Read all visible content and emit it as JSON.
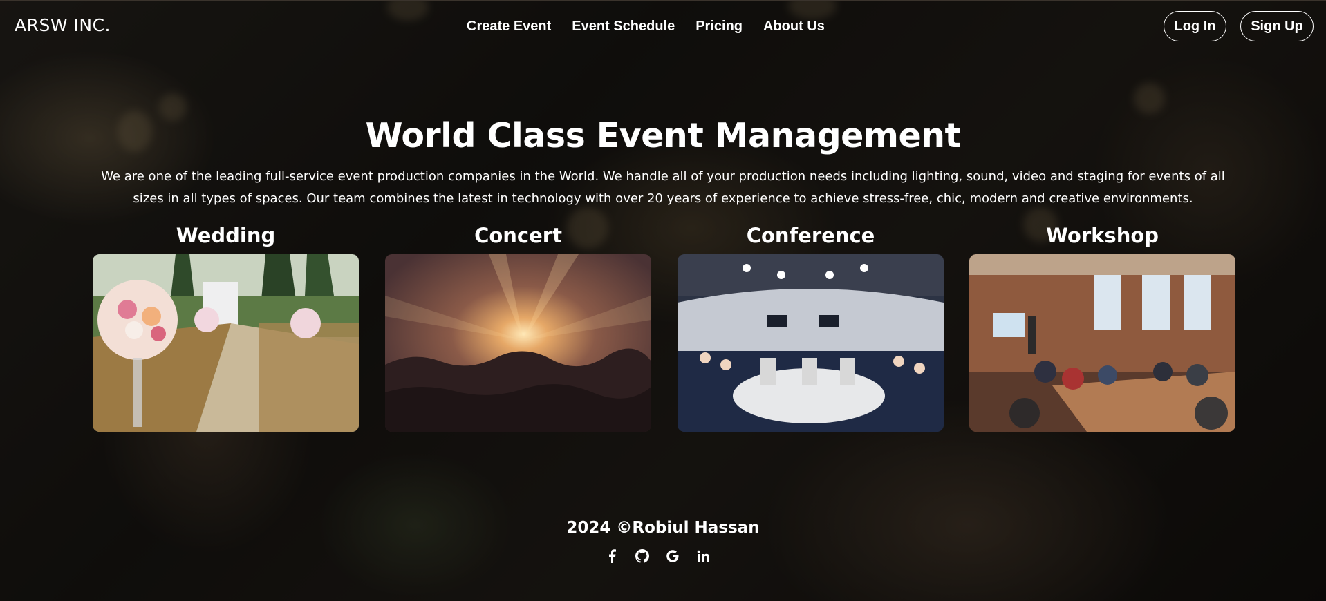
{
  "brand": {
    "name": "ARSW INC."
  },
  "nav": {
    "items": [
      {
        "label": "Create Event"
      },
      {
        "label": "Event Schedule"
      },
      {
        "label": "Pricing"
      },
      {
        "label": "About Us"
      }
    ],
    "login_label": "Log In",
    "signup_label": "Sign Up"
  },
  "hero": {
    "title": "World Class Event Management",
    "description": "We are one of the leading full-service event production companies in the World. We handle all of your production needs including lighting, sound, video and staging for events of all sizes in all types of spaces. Our team combines the latest in technology with over 20 years of experience to achieve stress-free, chic, modern and creative environments."
  },
  "categories": [
    {
      "title": "Wedding"
    },
    {
      "title": "Concert"
    },
    {
      "title": "Conference"
    },
    {
      "title": "Workshop"
    }
  ],
  "footer": {
    "copyright": "2024 ©Robiul Hassan",
    "social_icons": [
      "facebook-icon",
      "github-icon",
      "google-icon",
      "linkedin-icon"
    ]
  },
  "colors": {
    "text": "#ffffff",
    "overlay": "rgba(0,0,0,0.45)"
  }
}
